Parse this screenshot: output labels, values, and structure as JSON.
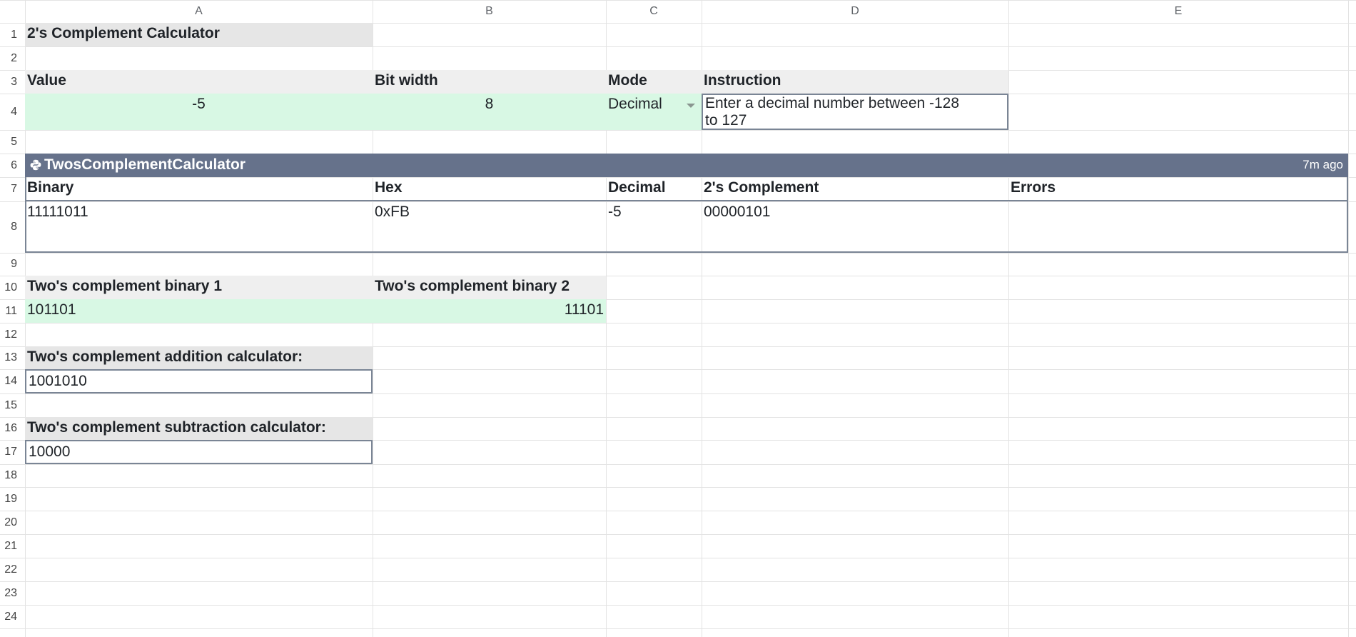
{
  "columns": [
    "A",
    "B",
    "C",
    "D",
    "E"
  ],
  "rows": [
    "1",
    "2",
    "3",
    "4",
    "5",
    "6",
    "7",
    "8",
    "9",
    "10",
    "11",
    "12",
    "13",
    "14",
    "15",
    "16",
    "17",
    "18",
    "19",
    "20",
    "21",
    "22",
    "23",
    "24"
  ],
  "title": "2's Complement Calculator",
  "inputs": {
    "value_label": "Value",
    "bitwidth_label": "Bit width",
    "mode_label": "Mode",
    "instruction_label": "Instruction",
    "value": "-5",
    "bitwidth": "8",
    "mode": "Decimal",
    "instruction_line1": "Enter a decimal number between -128",
    "instruction_line2": "to 127"
  },
  "calculator": {
    "name": "TwosComplementCalculator",
    "updated": "7m ago",
    "headers": [
      "Binary",
      "Hex",
      "Decimal",
      "2's Complement",
      "Errors"
    ],
    "row": [
      "11111011",
      "0xFB",
      "-5",
      "00000101",
      ""
    ]
  },
  "binary_inputs": {
    "label1": "Two's complement binary 1",
    "label2": "Two's complement binary 2",
    "value1": "101101",
    "value2": "11101"
  },
  "addition": {
    "label": "Two's complement addition calculator:",
    "result": "1001010"
  },
  "subtraction": {
    "label": "Two's complement subtraction calculator:",
    "result": "10000"
  },
  "colors": {
    "header_gray": "#e6e6e6",
    "input_green": "#d8f8e4",
    "banner": "#66728b"
  }
}
